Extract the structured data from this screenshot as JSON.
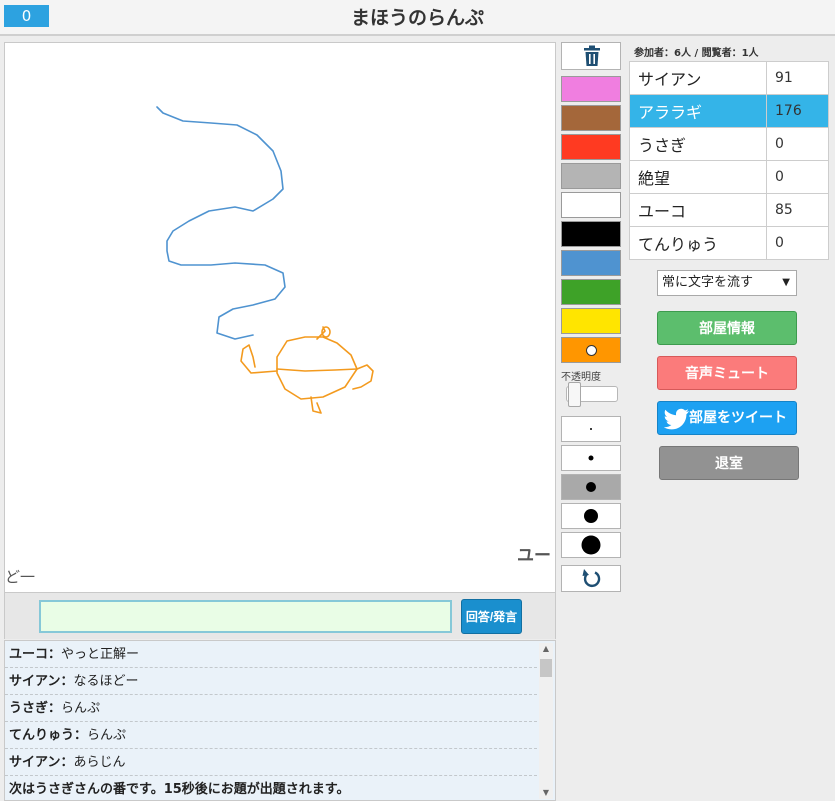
{
  "header": {
    "score": "0",
    "title": "まほうのらんぷ"
  },
  "canvas": {
    "overlay_left": "ど一",
    "overlay_right": "ユー",
    "stroke_colors": {
      "smoke": "#4f93d0",
      "lamp": "#f39a1e"
    }
  },
  "answer": {
    "value": "",
    "placeholder": "",
    "button_label": "回答/発言"
  },
  "chat": [
    {
      "name": "ユーコ",
      "sep": "：",
      "text": "やっと正解ー"
    },
    {
      "name": "サイアン",
      "sep": "：",
      "text": "なるほどー"
    },
    {
      "name": "うさぎ",
      "sep": "：",
      "text": "らんぷ"
    },
    {
      "name": "てんりゅう",
      "sep": "：",
      "text": "らんぷ"
    },
    {
      "name": "サイアン",
      "sep": "：",
      "text": "あらじん"
    }
  ],
  "chat_system": "次はうさぎさんの番です。15秒後にお題が出題されます。",
  "palette": {
    "colors": [
      "#f07ee0",
      "#a4673a",
      "#ff3a21",
      "#b4b4b4",
      "#ffffff",
      "#000000",
      "#4f93d0",
      "#3ea228",
      "#ffe500",
      "#ff9600"
    ],
    "selected_index": 9
  },
  "opacity_label": "不透明度",
  "opacity_value": 0,
  "counts": "参加者：6人 / 閲覧者：1人",
  "players": [
    {
      "name": "サイアン",
      "score": "91"
    },
    {
      "name": "アララギ",
      "score": "176"
    },
    {
      "name": "うさぎ",
      "score": "0"
    },
    {
      "name": "絶望",
      "score": "0"
    },
    {
      "name": "ユーコ",
      "score": "85"
    },
    {
      "name": "てんりゅう",
      "score": "0"
    }
  ],
  "active_player_index": 1,
  "mode_select": {
    "value": "常に文字を流す"
  },
  "buttons": {
    "room_info": "部屋情報",
    "mute": "音声ミュート",
    "tweet": "部屋をツイート",
    "exit": "退室"
  },
  "icons": {
    "trash": "trash-icon",
    "undo": "undo-icon",
    "tweet": "twitter-bird-icon",
    "dropdown": "dropdown-arrow-icon"
  }
}
